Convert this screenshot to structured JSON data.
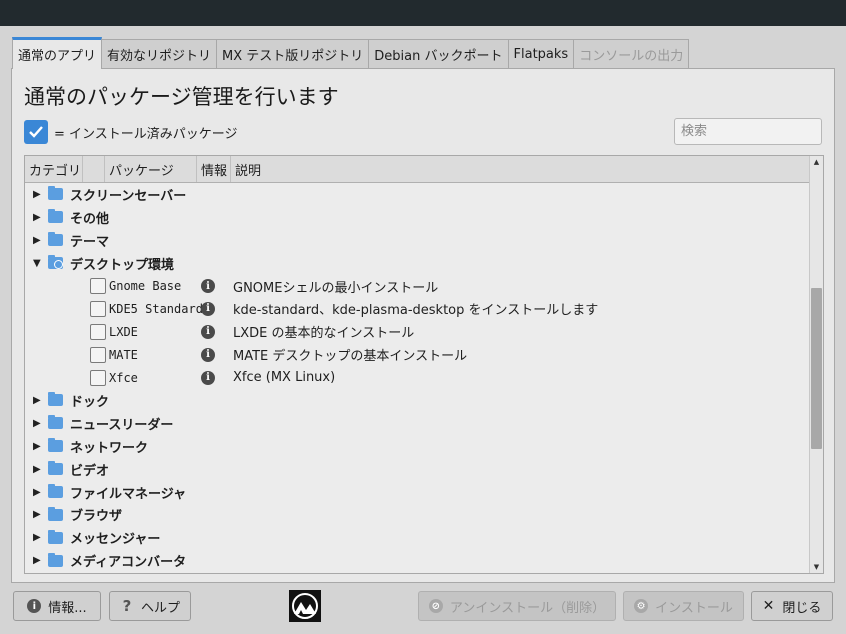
{
  "tabs": [
    {
      "label": "通常のアプリ",
      "active": true
    },
    {
      "label": "有効なリポジトリ"
    },
    {
      "label": "MX テスト版リポジトリ"
    },
    {
      "label": "Debian バックポート"
    },
    {
      "label": "Flatpaks"
    },
    {
      "label": "コンソールの出力",
      "disabled": true
    }
  ],
  "main": {
    "title": "通常のパッケージ管理を行います",
    "legend": "= インストール済みパッケージ",
    "search_placeholder": "検索"
  },
  "tree": {
    "columns": [
      "カテゴリ",
      "パッケージ",
      "情報",
      "説明"
    ],
    "categories_before": [
      "スクリーンセーバー",
      "その他",
      "テーマ"
    ],
    "expanded_category": "デスクトップ環境",
    "packages": [
      {
        "name": "Gnome Base",
        "description": "GNOMEシェルの最小インストール",
        "installed": false
      },
      {
        "name": "KDE5 Standard",
        "description": "kde-standard、kde-plasma-desktop をインストールします",
        "installed": false
      },
      {
        "name": "LXDE",
        "description": "LXDE の基本的なインストール",
        "installed": false
      },
      {
        "name": "MATE",
        "description": "MATE デスクトップの基本インストール",
        "installed": false
      },
      {
        "name": "Xfce",
        "description": "Xfce (MX Linux)",
        "installed": false
      }
    ],
    "categories_after": [
      "ドック",
      "ニュースリーダー",
      "ネットワーク",
      "ビデオ",
      "ファイルマネージャ",
      "ブラウザ",
      "メッセンジャー",
      "メディアコンバータ"
    ]
  },
  "footer": {
    "info_label": "情報...",
    "help_label": "ヘルプ",
    "uninstall_label": "アンインストール（削除）",
    "install_label": "インストール",
    "close_label": "閉じる"
  },
  "colors": {
    "accent": "#3a87d6",
    "folder": "#5b9ee0",
    "titlebar": "#222a2e"
  }
}
